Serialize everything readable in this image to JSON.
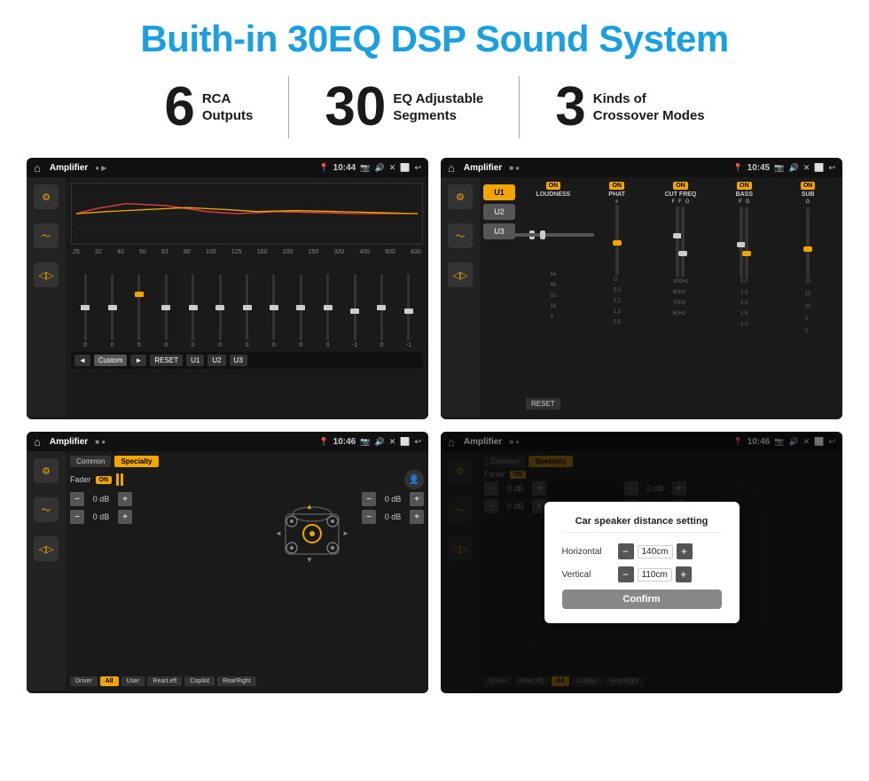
{
  "title": "Buith-in 30EQ DSP Sound System",
  "stats": [
    {
      "number": "6",
      "line1": "RCA",
      "line2": "Outputs"
    },
    {
      "number": "30",
      "line1": "EQ Adjustable",
      "line2": "Segments"
    },
    {
      "number": "3",
      "line1": "Kinds of",
      "line2": "Crossover Modes"
    }
  ],
  "screens": [
    {
      "title": "Amplifier",
      "time": "10:44",
      "type": "eq"
    },
    {
      "title": "Amplifier",
      "time": "10:45",
      "type": "amp"
    },
    {
      "title": "Amplifier",
      "time": "10:46",
      "type": "fader"
    },
    {
      "title": "Amplifier",
      "time": "10:46",
      "type": "dialog"
    }
  ],
  "eq": {
    "freqs": [
      "25",
      "32",
      "40",
      "50",
      "63",
      "80",
      "100",
      "125",
      "160",
      "200",
      "250",
      "320",
      "400",
      "500",
      "630"
    ],
    "values": [
      "0",
      "0",
      "0",
      "5",
      "0",
      "0",
      "0",
      "0",
      "0",
      "0",
      "-1",
      "0",
      "-1"
    ],
    "nav": [
      "◄",
      "Custom",
      "►",
      "RESET",
      "U1",
      "U2",
      "U3"
    ]
  },
  "amp": {
    "uButtons": [
      "U1",
      "U2",
      "U3"
    ],
    "controls": [
      "LOUDNESS",
      "PHAT",
      "CUT FREQ",
      "BASS",
      "SUB"
    ],
    "resetLabel": "RESET"
  },
  "fader": {
    "tabs": [
      "Common",
      "Specialty"
    ],
    "faderLabel": "Fader",
    "onLabel": "ON",
    "dbValues": [
      "0 dB",
      "0 dB",
      "0 dB",
      "0 dB"
    ],
    "bottomBtns": [
      "Driver",
      "RearLeft",
      "All",
      "User",
      "RearRight",
      "Copilot"
    ]
  },
  "dialog": {
    "title": "Car speaker distance setting",
    "horizontalLabel": "Horizontal",
    "horizontalValue": "140cm",
    "verticalLabel": "Vertical",
    "verticalValue": "110cm",
    "confirmLabel": "Confirm",
    "faderLabel": "Fader",
    "tabs": [
      "Common",
      "Specialty"
    ]
  }
}
